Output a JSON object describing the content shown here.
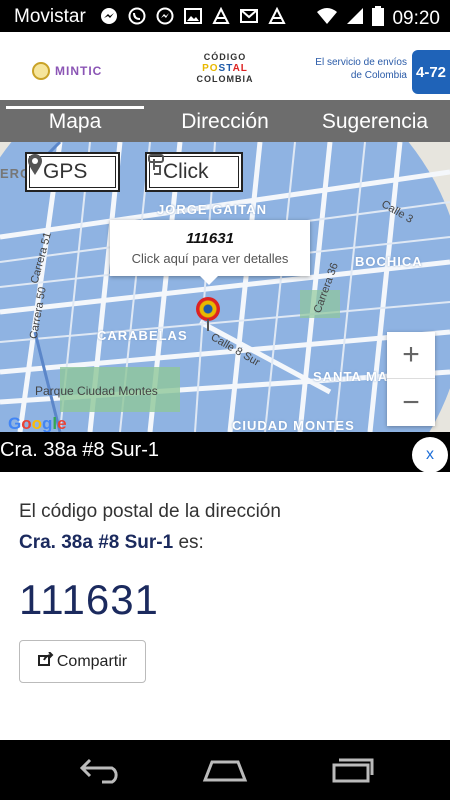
{
  "status": {
    "carrier": "Movistar",
    "time": "09:20"
  },
  "header": {
    "mintic": "MINTIC",
    "logo_line1": "CÓDIGO",
    "logo_postal": [
      "PO",
      "ST",
      "AL"
    ],
    "logo_line3": "COLOMBIA",
    "envios_line1": "El servicio de envíos",
    "envios_line2": "de Colombia",
    "badge": "4-72"
  },
  "tabs": [
    {
      "label": "Mapa",
      "active": true
    },
    {
      "label": "Dirección",
      "active": false
    },
    {
      "label": "Sugerencia",
      "active": false
    }
  ],
  "map": {
    "gps_label": "GPS",
    "click_label": "Click",
    "popup_code": "111631",
    "popup_hint": "Click aquí para ver detalles",
    "labels": {
      "jorge_gaitan": "JORGE GAITAN",
      "bochica": "BOCHICA",
      "carabelas": "CARABELAS",
      "santa_matilde": "SANTA MATILDE",
      "ciudad_montes": "CIUDAD MONTES",
      "parque": "Parque Ciudad Montes",
      "calle3": "Calle 3",
      "carrera51": "Carrera 51",
      "carrera50": "Carrera 50",
      "carrera36": "Carrera 36",
      "calle8sur": "Calle 8 Sur",
      "cerca": "ERO"
    },
    "zoom_in": "+",
    "zoom_out": "−",
    "google": [
      "G",
      "o",
      "o",
      "g",
      "l",
      "e"
    ]
  },
  "address": {
    "text": "Cra. 38a #8 Sur-1",
    "close_label": "x"
  },
  "result": {
    "line1": "El código postal de la dirección",
    "address_bold": "Cra. 38a #8 Sur-1",
    "line2_suffix": " es:",
    "postal_code": "111631",
    "share_label": "Compartir"
  },
  "colors": {
    "accent_navy": "#1b2a5e",
    "tab_bg": "#6d6d6d",
    "map_blue": "#8fb3e2"
  }
}
